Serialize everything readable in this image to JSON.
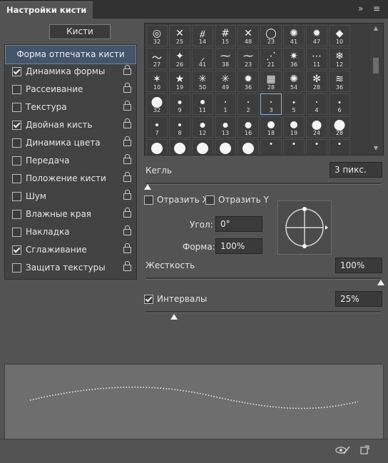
{
  "window": {
    "title": "Настройки кисти"
  },
  "brushes_button": "Кисти",
  "left_list": {
    "header": "Форма отпечатка кисти",
    "items": [
      {
        "label": "Динамика формы",
        "checked": true,
        "lock": true
      },
      {
        "label": "Рассеивание",
        "checked": false,
        "lock": true
      },
      {
        "label": "Текстура",
        "checked": false,
        "lock": true
      },
      {
        "label": "Двойная кисть",
        "checked": true,
        "lock": true
      },
      {
        "label": "Динамика цвета",
        "checked": false,
        "lock": true
      },
      {
        "label": "Передача",
        "checked": false,
        "lock": true
      },
      {
        "label": "Положение кисти",
        "checked": false,
        "lock": true
      },
      {
        "label": "Шум",
        "checked": false,
        "lock": true
      },
      {
        "label": "Влажные края",
        "checked": false,
        "lock": true
      },
      {
        "label": "Накладка",
        "checked": false,
        "lock": true
      },
      {
        "label": "Сглаживание",
        "checked": true,
        "lock": true
      },
      {
        "label": "Защита текстуры",
        "checked": false,
        "lock": true
      }
    ]
  },
  "brush_grid": {
    "rows": [
      [
        "32",
        "25",
        "14",
        "15",
        "48",
        "23",
        "41",
        "47",
        "10"
      ],
      [
        "27",
        "26",
        "41",
        "38",
        "23",
        "21",
        "36",
        "11",
        "12"
      ],
      [
        "10",
        "19",
        "50",
        "49",
        "36",
        "28",
        "54",
        "28",
        "36"
      ],
      [
        "32",
        "9",
        "11",
        "1",
        "2",
        "3",
        "5",
        "4",
        "6"
      ],
      [
        "7",
        "8",
        "12",
        "13",
        "16",
        "18",
        "19",
        "24",
        "28"
      ]
    ],
    "selected": "3"
  },
  "size": {
    "label": "Кегль",
    "value": "3 пикс.",
    "fraction": 0.01
  },
  "flip_x": {
    "label": "Отразить X",
    "checked": false
  },
  "flip_y": {
    "label": "Отразить Y",
    "checked": false
  },
  "angle": {
    "label": "Угол:",
    "value": "0°"
  },
  "roundness": {
    "label": "Форма:",
    "value": "100%"
  },
  "hardness": {
    "label": "Жесткость",
    "value": "100%",
    "fraction": 1.0
  },
  "spacing": {
    "label": "Интервалы",
    "value": "25%",
    "checked": true,
    "fraction": 0.12
  }
}
